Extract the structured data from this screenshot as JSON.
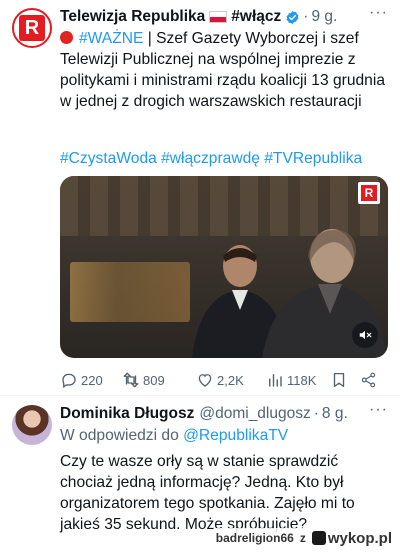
{
  "tweet1": {
    "display_name": "Telewizja Republika",
    "name_suffix": "#włącz",
    "time": "9 g.",
    "label_important": "#WAŻNE",
    "separator": "|",
    "text_rest": " Szef Gazety Wyborczej i szef Telewizji Publicznej na wspólnej imprezie z politykami i ministrami rządu koalicji 13 grudnia w jednej z drogich warszawskich restauracji",
    "hashtags": "#CzystaWoda #włączprawdę #TVRepublika",
    "stats": {
      "replies": "220",
      "retweets": "809",
      "likes": "2,2K",
      "views": "118K"
    }
  },
  "tweet2": {
    "display_name": "Dominika Długosz",
    "handle": "@domi_dlugosz",
    "time": "8 g.",
    "reply_prefix": "W odpowiedzi do ",
    "reply_handle": "@RepublikaTV",
    "text": "Czy te wasze orły są w stanie sprawdzić chociaż jedną informację? Jedną. Kto był organizatorem tego spotkania. Zajęło mi to jakieś 35 sekund. Może spróbujcie?"
  },
  "watermark": {
    "user": "badreligion66",
    "joiner": "z",
    "site": "wykop.pl"
  },
  "colors": {
    "link": "#1d9bf0",
    "muted": "#536471",
    "brand_red": "#e31b23"
  }
}
